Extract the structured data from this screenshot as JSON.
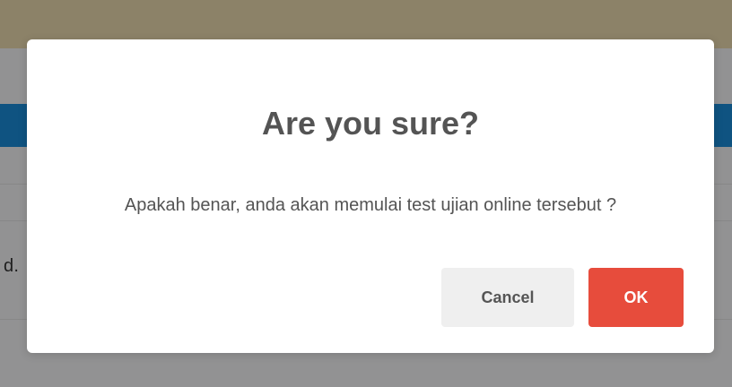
{
  "background": {
    "partial_text": "d."
  },
  "dialog": {
    "title": "Are you sure?",
    "message": "Apakah benar, anda akan memulai test ujian online tersebut ?",
    "cancel_label": "Cancel",
    "ok_label": "OK"
  },
  "colors": {
    "ok_button": "#e74c3c",
    "cancel_button": "#efefef",
    "blue_band": "#1a8ad7",
    "top_bar": "#e9d9ad"
  }
}
